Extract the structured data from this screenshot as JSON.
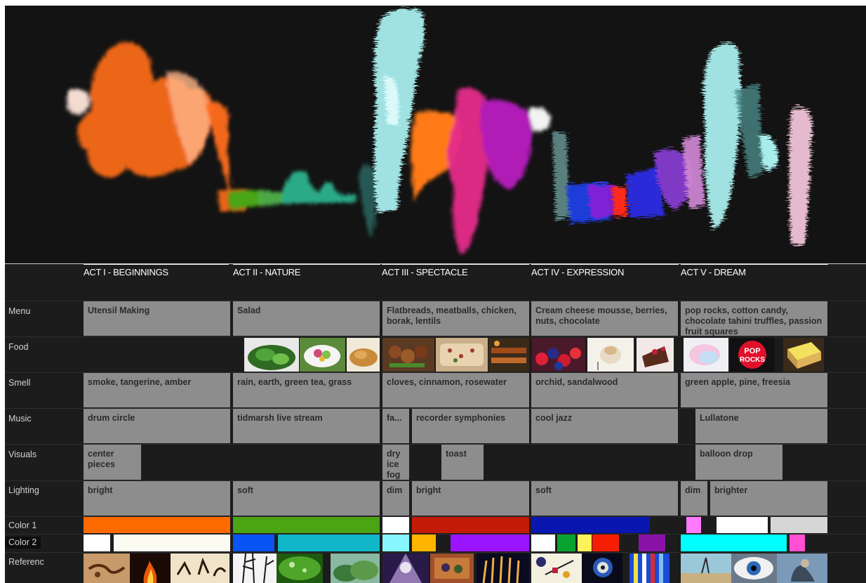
{
  "acts": [
    "ACT I - BEGINNINGS",
    "ACT II - NATURE",
    "ACT III - SPECTACLE",
    "ACT IV - EXPRESSION",
    "ACT V - DREAM"
  ],
  "rows": {
    "menu": "Menu",
    "food": "Food",
    "smell": "Smell",
    "music": "Music",
    "visuals": "Visuals",
    "lighting": "Lighting",
    "color1": "Color 1",
    "color2": "Color 2",
    "reference": "Referenc"
  },
  "menu": {
    "act1": "Utensil Making",
    "act2": "Salad",
    "act3": "Flatbreads, meatballs, chicken, borak, lentils",
    "act4": "Cream cheese mousse, berries, nuts, chocolate",
    "act5": "pop rocks, cotton candy, chocolate tahini truffles, passion fruit squares"
  },
  "food_images": {
    "act2": [
      "greens-photo",
      "salad-bowl-photo",
      "bread-photo"
    ],
    "act3": [
      "meatballs-photo",
      "flatbread-photo",
      "grill-photo"
    ],
    "act4": [
      "berries-photo",
      "mousse-photo",
      "chocolate-cake-photo"
    ],
    "act5": [
      "cotton-candy-photo",
      "pop-rocks-photo",
      "passion-fruit-square-photo"
    ],
    "pop_rocks_text": "POP ROCKS"
  },
  "smell": {
    "act1": "smoke, tangerine, amber",
    "act2": "rain, earth, green tea, grass",
    "act3": "cloves, cinnamon, rosewater",
    "act4": "orchid, sandalwood",
    "act5": "green apple, pine, freesia"
  },
  "music": {
    "act1": "drum circle",
    "act2": "tidmarsh live stream",
    "act3a": "fa...",
    "act3b": "recorder symphonies",
    "act4": "cool jazz",
    "act5": "Lullatone"
  },
  "visuals": {
    "act1": "center pieces",
    "act3a": "dry ice fog",
    "act3b": "toast",
    "act5": "balloon drop"
  },
  "lighting": {
    "act1": "bright",
    "act2": "soft",
    "act3a": "dim",
    "act3b": "bright",
    "act4": "soft",
    "act5a": "dim",
    "act5b": "brighter"
  },
  "colors": {
    "cell_gray": "#8d8d8d",
    "background": "#1c1c1c",
    "color1": [
      "#ff6a00",
      "#4aa414",
      "#ffffff",
      "#c41b06",
      "#0a16b0",
      "#ff7aff",
      "#ffffff",
      "#d6d6d6"
    ],
    "color2": [
      "#ffffff",
      "#fbfbf1",
      "#0a53f5",
      "#11b7c8",
      "#88f6ff",
      "#ffb400",
      "#9a14ff",
      "#ffffff",
      "#08a231",
      "#fcf35b",
      "#f51d04",
      "#8812a8",
      "#00ffff",
      "#ff4fd2"
    ]
  },
  "reference_images": [
    "cave-painting",
    "fire",
    "tribal-drawing",
    "bamboo",
    "leaf",
    "garden",
    "concert-lights",
    "tapestry",
    "fountain-show",
    "kandinsky-1",
    "kandinsky-2",
    "paint-streaks",
    "dali-landscape",
    "eye-surreal",
    "dali-figure"
  ]
}
